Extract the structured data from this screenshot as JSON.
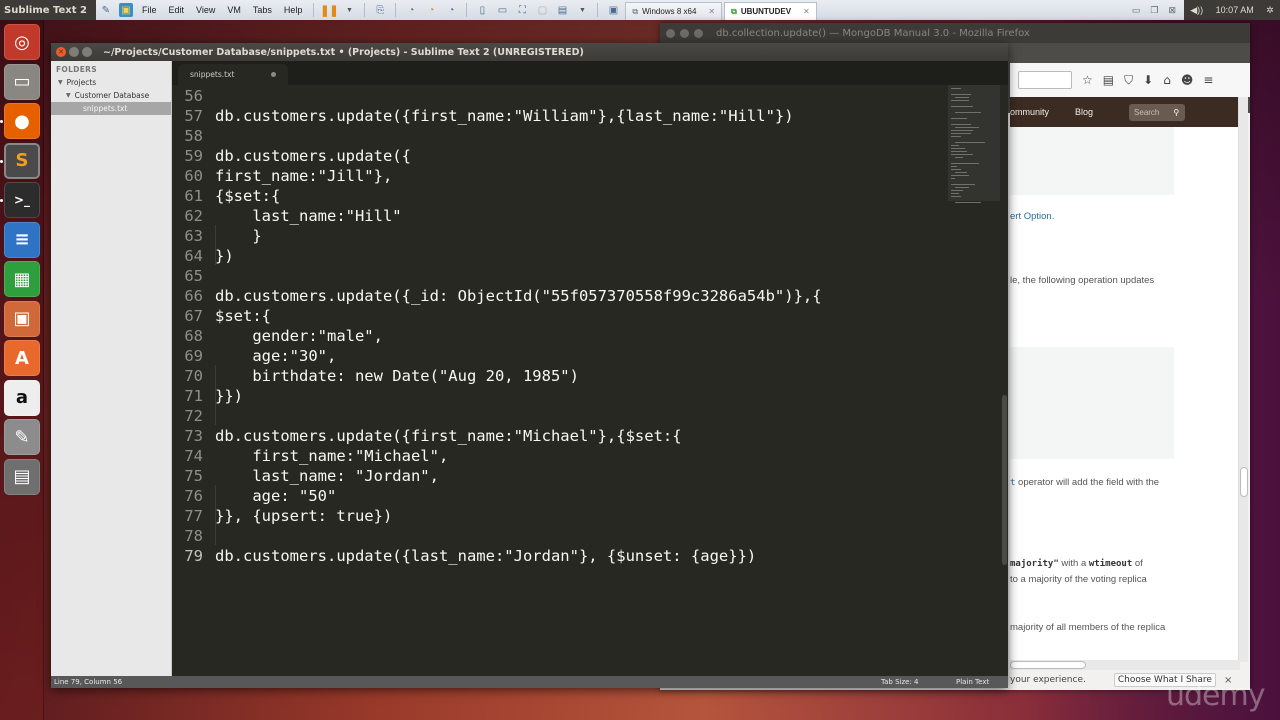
{
  "host": {
    "active_app": "Sublime Text 2",
    "menu": [
      "File",
      "Edit",
      "View",
      "VM",
      "Tabs",
      "Help"
    ],
    "vm_tabs": [
      {
        "label": "Windows 8 x64",
        "active": false
      },
      {
        "label": "UBUNTUDEV",
        "active": true
      }
    ],
    "clock": "10:07 AM",
    "icons": {
      "pin": "pin-icon",
      "home": "vmware-home-icon",
      "pause": "pause-icon",
      "send_keys": "send-ctrl-alt-del-icon",
      "snapshot": "snapshot-icon",
      "revert": "revert-snapshot-icon",
      "manager": "snapshot-manager-icon",
      "sidebar": "show-library-icon",
      "thumbnail": "thumbnail-icon",
      "fullscreen": "fullscreen-icon",
      "unity": "unity-icon",
      "console": "console-view-icon",
      "volume": "volume-icon",
      "gear": "session-gear-icon"
    }
  },
  "launcher": {
    "items": [
      {
        "name": "ubuntu-dash",
        "color": "#c0392b",
        "glyph": "◎"
      },
      {
        "name": "files",
        "color": "#8a8782",
        "glyph": "▭"
      },
      {
        "name": "firefox",
        "color": "#e66000",
        "glyph": "●",
        "running": true
      },
      {
        "name": "sublime-text",
        "color": "#4a4a4a",
        "glyph": "S",
        "running": true,
        "focused": true
      },
      {
        "name": "terminal",
        "color": "#2c2c2c",
        "glyph": ">_",
        "running": true
      },
      {
        "name": "libreoffice-writer",
        "color": "#2f73c4",
        "glyph": "≡"
      },
      {
        "name": "libreoffice-calc",
        "color": "#2f9e3c",
        "glyph": "▦"
      },
      {
        "name": "libreoffice-impress",
        "color": "#d0683a",
        "glyph": "▣"
      },
      {
        "name": "software-center",
        "color": "#e8692b",
        "glyph": "A"
      },
      {
        "name": "amazon",
        "color": "#eeeeee",
        "glyph": "a"
      },
      {
        "name": "system-settings",
        "color": "#8c8c8c",
        "glyph": "✎"
      },
      {
        "name": "save-disk",
        "color": "#6f6f6f",
        "glyph": "▤"
      }
    ]
  },
  "firefox": {
    "title": "db.collection.update() — MongoDB Manual 3.0 - Mozilla Firefox",
    "site_nav": [
      "ommunity",
      "Blog"
    ],
    "search_placeholder": "Search",
    "fragments": {
      "link1": "ert Option.",
      "text1": "le, the following operation updates",
      "text2_code": "t",
      "text2": " operator will add the field with the",
      "text3_code_a": "majority\"",
      "text3_mid": " with a ",
      "text3_code_b": "wtimeout",
      "text3_end": " of",
      "text4": " to a majority of the voting replica",
      "text5": "majority of all members of the replica"
    },
    "notification": {
      "text": "your experience.",
      "button": "Choose What I Share",
      "close": "×"
    }
  },
  "sublime": {
    "title": "~/Projects/Customer Database/snippets.txt • (Projects) - Sublime Text 2 (UNREGISTERED)",
    "sidebar": {
      "header": "FOLDERS",
      "tree": [
        {
          "label": "Projects",
          "level": 0,
          "expanded": true
        },
        {
          "label": "Customer Database",
          "level": 1,
          "expanded": true
        },
        {
          "label": "snippets.txt",
          "level": 2,
          "selected": true
        }
      ]
    },
    "tab": {
      "label": "snippets.txt",
      "dirty": true
    },
    "code": [
      {
        "n": "56",
        "text": ""
      },
      {
        "n": "57",
        "text": "db.customers.update({first_name:\"William\"},{last_name:\"Hill\"})"
      },
      {
        "n": "58",
        "text": ""
      },
      {
        "n": "59",
        "text": "db.customers.update({"
      },
      {
        "n": "60",
        "text": "first_name:\"Jill\"},"
      },
      {
        "n": "61",
        "text": "{$set:{"
      },
      {
        "n": "62",
        "text": "    last_name:\"Hill\""
      },
      {
        "n": "63",
        "text": "    }"
      },
      {
        "n": "64",
        "text": "})"
      },
      {
        "n": "65",
        "text": ""
      },
      {
        "n": "66",
        "text": "db.customers.update({_id: ObjectId(\"55f057370558f99c3286a54b\")},{"
      },
      {
        "n": "67",
        "text": "$set:{"
      },
      {
        "n": "68",
        "text": "    gender:\"male\","
      },
      {
        "n": "69",
        "text": "    age:\"30\","
      },
      {
        "n": "70",
        "text": "    birthdate: new Date(\"Aug 20, 1985\")"
      },
      {
        "n": "71",
        "text": "}})"
      },
      {
        "n": "72",
        "text": ""
      },
      {
        "n": "73",
        "text": "db.customers.update({first_name:\"Michael\"},{$set:{"
      },
      {
        "n": "74",
        "text": "    first_name:\"Michael\","
      },
      {
        "n": "75",
        "text": "    last_name: \"Jordan\","
      },
      {
        "n": "76",
        "text": "    age: \"50\""
      },
      {
        "n": "77",
        "text": "}}, {upsert: true})"
      },
      {
        "n": "78",
        "text": ""
      },
      {
        "n": "79",
        "text": "db.customers.update({last_name:\"Jordan\"}, {$unset: {age}})",
        "current": true
      }
    ],
    "status": {
      "position": "Line 79, Column 56",
      "tab_size": "Tab Size: 4",
      "syntax": "Plain Text"
    }
  },
  "watermark": "udemy"
}
